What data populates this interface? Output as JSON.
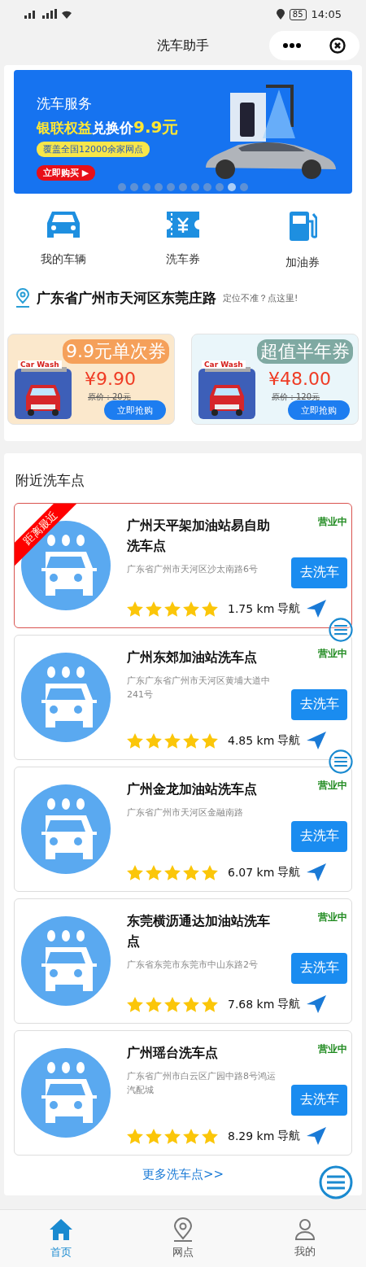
{
  "status_bar": {
    "time": "14:05",
    "battery": "85"
  },
  "nav": {
    "title": "洗车助手"
  },
  "banner": {
    "title": "洗车服务",
    "headline_highlight": "银联权益",
    "headline": "兑换价",
    "price": "9.9元",
    "coverage": "覆盖全国12000余家网点",
    "cta": "立即购买",
    "cta_icon": "▶",
    "dots": [
      {
        "selected": false
      },
      {
        "selected": false
      },
      {
        "selected": false
      },
      {
        "selected": false
      },
      {
        "selected": false
      },
      {
        "selected": false
      },
      {
        "selected": false
      },
      {
        "selected": false
      },
      {
        "selected": false
      },
      {
        "selected": true
      },
      {
        "selected": false
      }
    ]
  },
  "shortcuts": [
    {
      "kind": "car",
      "label": "我的车辆"
    },
    {
      "kind": "ticket",
      "label": "洗车券"
    },
    {
      "kind": "fuel",
      "label": "加油券"
    }
  ],
  "location": {
    "address": "广东省广州市天河区东莞庄路",
    "hint": "定位不准？点这里!"
  },
  "coupons": [
    {
      "title": "9.9元单次券",
      "sign": "Car Wash",
      "price": "¥9.90",
      "original": "原价：20元",
      "button": "立即抢购",
      "color": "#f5a05a"
    },
    {
      "title": "超值半年券",
      "sign": "Car Wash",
      "price": "¥48.00",
      "original": "原价：120元",
      "button": "立即抢购",
      "color": "#7fa9a2"
    }
  ],
  "nearby": {
    "title": "附近洗车点",
    "more": "更多洗车点>>",
    "stations": [
      {
        "name": "广州天平架加油站易自助洗车点",
        "address": "广东省广州市天河区沙太南路6号",
        "status": "营业中",
        "button": "去洗车",
        "stars": 5,
        "distance": "1.75 km",
        "nav": "导航",
        "highlighted": true,
        "badge": "距离最近"
      },
      {
        "name": "广州东郊加油站洗车点",
        "address": "广东广东省广州市天河区黄埔大道中241号",
        "status": "营业中",
        "button": "去洗车",
        "stars": 5,
        "distance": "4.85 km",
        "nav": "导航",
        "highlighted": false
      },
      {
        "name": "广州金龙加油站洗车点",
        "address": "广东省广州市天河区金融南路",
        "status": "营业中",
        "button": "去洗车",
        "stars": 5,
        "distance": "6.07 km",
        "nav": "导航",
        "highlighted": false
      },
      {
        "name": "东莞横沥通达加油站洗车点",
        "address": "广东省东莞市东莞市中山东路2号",
        "status": "营业中",
        "button": "去洗车",
        "stars": 5,
        "distance": "7.68 km",
        "nav": "导航",
        "highlighted": false
      },
      {
        "name": "广州瑶台洗车点",
        "address": "广东省广州市白云区广园中路8号鸿运汽配城",
        "status": "营业中",
        "button": "去洗车",
        "stars": 5,
        "distance": "8.29 km",
        "nav": "导航",
        "highlighted": false
      }
    ]
  },
  "floating_buttons": [
    {
      "kind": "menu"
    },
    {
      "kind": "menu"
    },
    {
      "kind": "menu"
    }
  ],
  "tab_bar": [
    {
      "kind": "home",
      "label": "首页",
      "selected": true
    },
    {
      "kind": "pin",
      "label": "网点",
      "selected": false
    },
    {
      "kind": "user",
      "label": "我的",
      "selected": false
    }
  ]
}
